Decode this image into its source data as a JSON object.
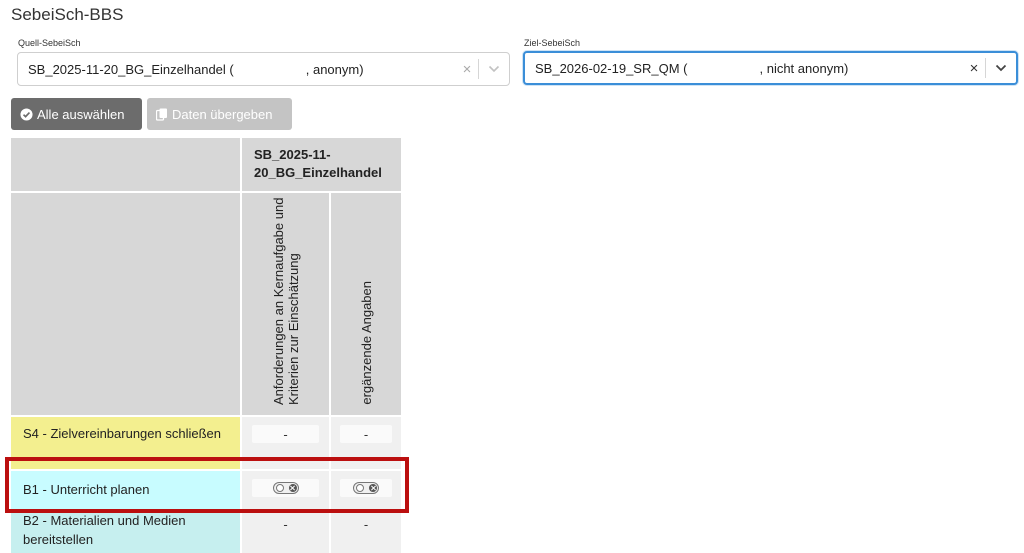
{
  "app": {
    "title": "SebeiSch-BBS"
  },
  "source": {
    "label": "Quell-SebeiSch",
    "value_part1": "SB_2025-11-20_BG_Einzelhandel (",
    "value_part2": ", anonym)",
    "clear_glyph": "×"
  },
  "target": {
    "label": "Ziel-SebeiSch",
    "value_part1": "SB_2026-02-19_SR_QM (",
    "value_part2": ", nicht anonym)",
    "clear_glyph": "×"
  },
  "toolbar": {
    "select_all_label": "Alle auswählen",
    "transfer_label": "Daten übergeben"
  },
  "table": {
    "group_header": "SB_2025-11-20_BG_Einzelhandel",
    "columns": [
      {
        "label": "Anforderungen an Kernaufgabe und Kriterien zur Einschätzung"
      },
      {
        "label": "ergänzende Angaben"
      }
    ],
    "rows": [
      {
        "label": "S4 - Zielvereinbarungen schließen",
        "cells": [
          "-",
          "-"
        ],
        "color": "#f3ef8f"
      },
      {
        "label": "B1 - Unterricht planen",
        "cells": [
          "toggle-off",
          "toggle-off"
        ],
        "color": "#c8fcff"
      },
      {
        "label": "B2 - Materialien und Medien bereitstellen",
        "cells": [
          "-",
          "-"
        ],
        "color": "#c6efef"
      }
    ]
  },
  "highlight": {
    "color": "#bb0f0f"
  }
}
